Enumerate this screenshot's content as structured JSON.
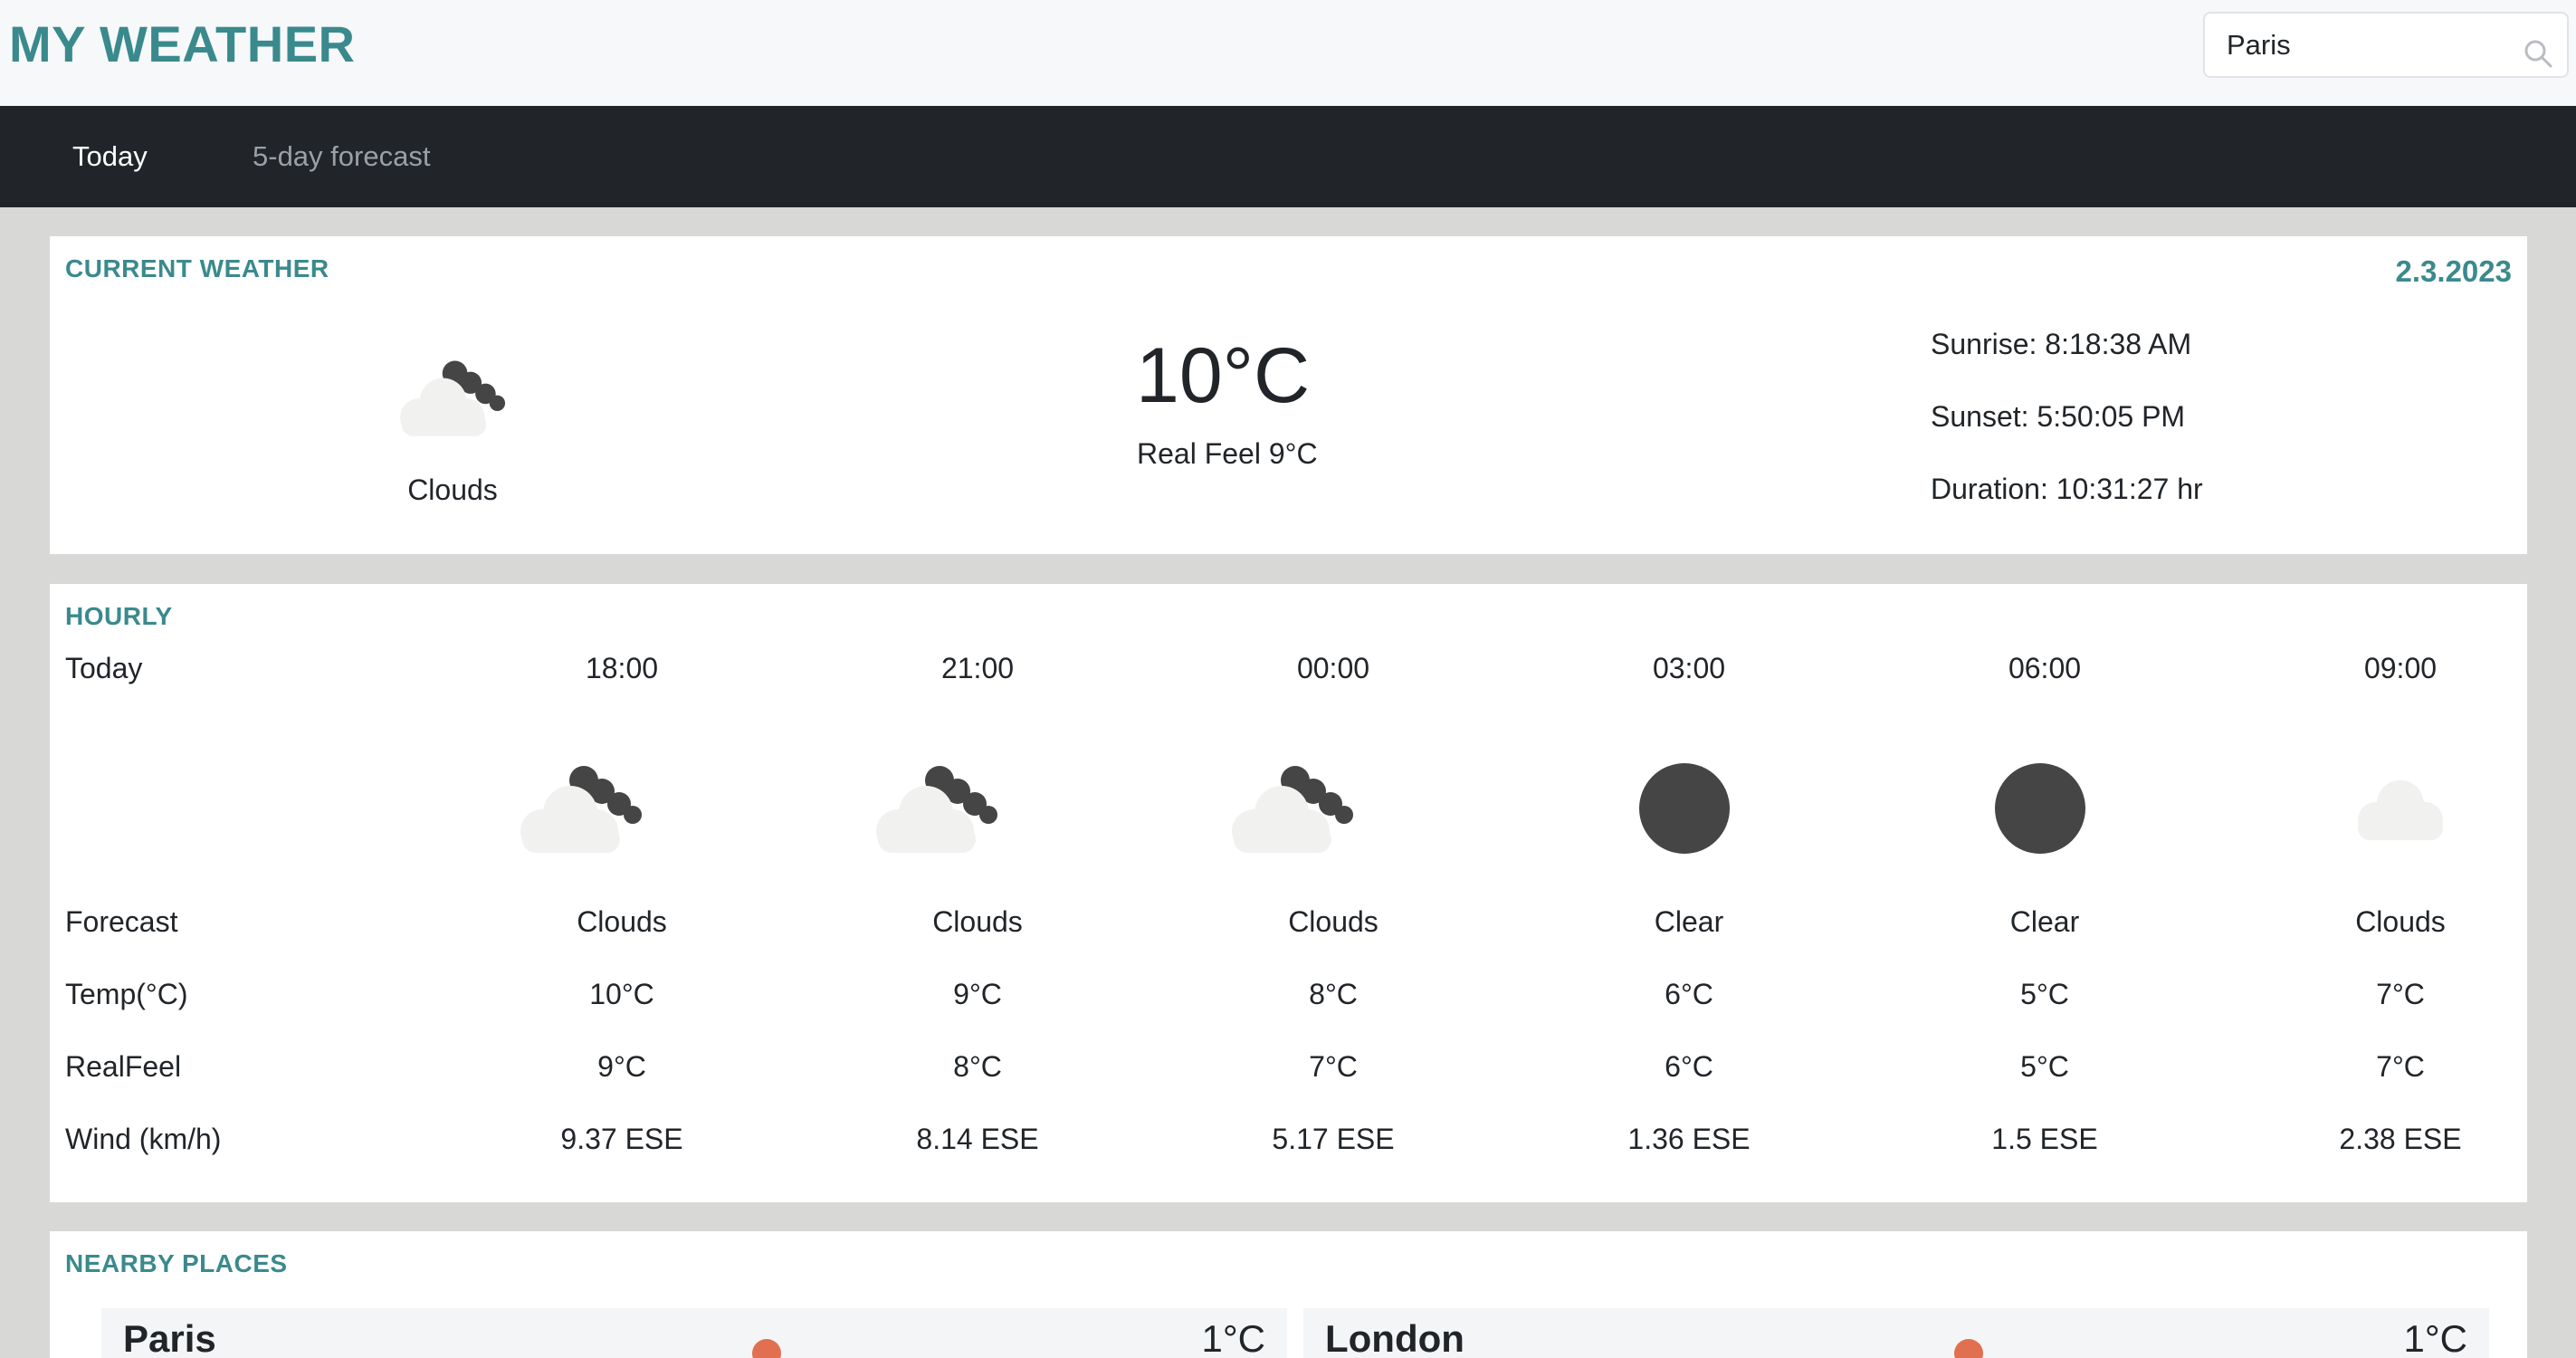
{
  "header": {
    "app_title": "MY WEATHER",
    "search_value": "Paris"
  },
  "nav": {
    "tabs": [
      {
        "label": "Today",
        "active": true
      },
      {
        "label": "5-day forecast",
        "active": false
      }
    ]
  },
  "current": {
    "title": "CURRENT WEATHER",
    "date": "2.3.2023",
    "condition": "Clouds",
    "icon": "cloud-moon-icon",
    "temperature": "10°C",
    "real_feel": "Real Feel 9°C",
    "sunrise": "Sunrise: 8:18:38 AM",
    "sunset": "Sunset: 5:50:05 PM",
    "duration": "Duration: 10:31:27 hr"
  },
  "hourly": {
    "title": "HOURLY",
    "labels": {
      "day": "Today",
      "forecast": "Forecast",
      "temp": "Temp(°C)",
      "realfeel": "RealFeel",
      "wind": "Wind (km/h)"
    },
    "hours": [
      {
        "time": "18:00",
        "forecast": "Clouds",
        "temp": "10°C",
        "realfeel": "9°C",
        "wind": "9.37 ESE",
        "icon": "cloud-moon-icon"
      },
      {
        "time": "21:00",
        "forecast": "Clouds",
        "temp": "9°C",
        "realfeel": "8°C",
        "wind": "8.14 ESE",
        "icon": "cloud-moon-icon"
      },
      {
        "time": "00:00",
        "forecast": "Clouds",
        "temp": "8°C",
        "realfeel": "7°C",
        "wind": "5.17 ESE",
        "icon": "cloud-moon-icon"
      },
      {
        "time": "03:00",
        "forecast": "Clear",
        "temp": "6°C",
        "realfeel": "6°C",
        "wind": "1.36 ESE",
        "icon": "moon-icon"
      },
      {
        "time": "06:00",
        "forecast": "Clear",
        "temp": "5°C",
        "realfeel": "5°C",
        "wind": "1.5 ESE",
        "icon": "moon-icon"
      },
      {
        "time": "09:00",
        "forecast": "Clouds",
        "temp": "7°C",
        "realfeel": "7°C",
        "wind": "2.38 ESE",
        "icon": "cloud-icon"
      }
    ]
  },
  "nearby": {
    "title": "NEARBY PLACES",
    "places": [
      {
        "name": "Paris",
        "temp": "1°C",
        "icon": "sun-icon"
      },
      {
        "name": "London",
        "temp": "1°C",
        "icon": "sun-icon"
      }
    ]
  },
  "colors": {
    "accent": "#3a8a8d",
    "nav_bg": "#212529",
    "page_bg": "#d8d8d6",
    "icon_dark": "#454545",
    "cloud_light": "#f1f1f0",
    "sun": "#e0704f"
  }
}
